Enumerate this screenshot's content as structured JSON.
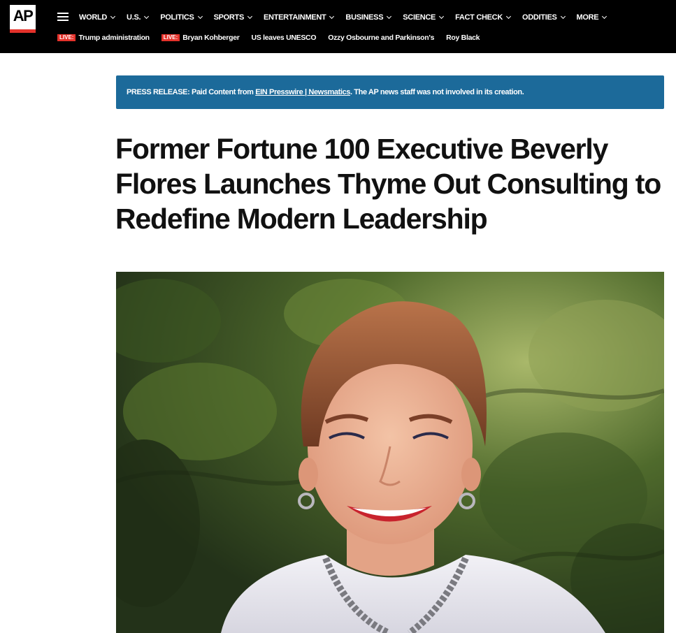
{
  "brand": {
    "logo_text": "AP",
    "accent_color": "#e4322b",
    "header_bg": "#000000"
  },
  "nav": {
    "menu_icon": "hamburger-menu-icon",
    "items": [
      {
        "label": "WORLD"
      },
      {
        "label": "U.S."
      },
      {
        "label": "POLITICS"
      },
      {
        "label": "SPORTS"
      },
      {
        "label": "ENTERTAINMENT"
      },
      {
        "label": "BUSINESS"
      },
      {
        "label": "SCIENCE"
      },
      {
        "label": "FACT CHECK"
      },
      {
        "label": "ODDITIES"
      },
      {
        "label": "MORE"
      }
    ]
  },
  "trending": {
    "live_label": "LIVE:",
    "items": [
      {
        "label": "Trump administration",
        "live": true
      },
      {
        "label": "Bryan Kohberger",
        "live": true
      },
      {
        "label": "US leaves UNESCO",
        "live": false
      },
      {
        "label": "Ozzy Osbourne and Parkinson's",
        "live": false
      },
      {
        "label": "Roy Black",
        "live": false
      }
    ]
  },
  "press_release": {
    "prefix": "PRESS RELEASE: Paid Content from ",
    "link1": "EIN Presswire",
    "separator": " | ",
    "link2": "Newsmatics",
    "suffix": ". The AP news staff was not involved in its creation.",
    "bg_color": "#1c6a9a"
  },
  "article": {
    "headline": "Former Fortune 100 Executive Beverly Flores Launches Thyme Out Consulting to Redefine Modern Leadership",
    "hero_image": "portrait-photo"
  }
}
